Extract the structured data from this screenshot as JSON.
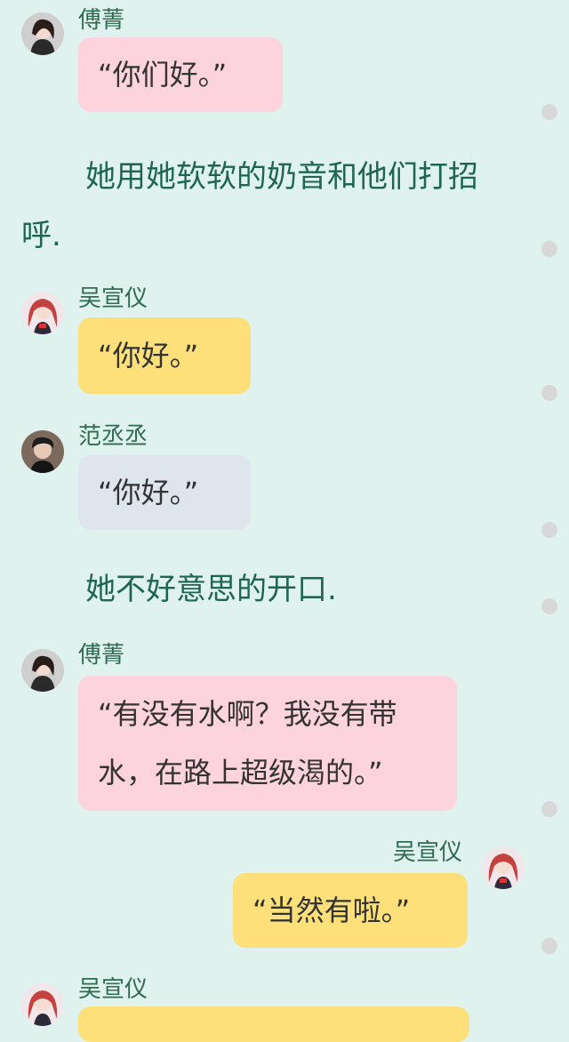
{
  "messages": {
    "m1": {
      "name": "傅菁",
      "text": "“你们好。”"
    },
    "narration1": {
      "line1": "她用她软软的奶音和他们打招",
      "line2": "呼."
    },
    "m2": {
      "name": "吴宣仪",
      "text": "“你好。”"
    },
    "m3": {
      "name": "范丞丞",
      "text": "“你好。”"
    },
    "narration2": {
      "line1": "她不好意思的开口."
    },
    "m4": {
      "name": "傅菁",
      "line1": "“有没有水啊？我没有带",
      "line2": "水，在路上超级渴的。”"
    },
    "m5": {
      "name": "吴宣仪",
      "text": "“当然有啦。”"
    },
    "m6": {
      "name": "吴宣仪",
      "text": ""
    }
  },
  "colors": {
    "background": "#e0f2ee",
    "pink_bubble": "#fdd3dd",
    "yellow_bubble": "#fde07a",
    "grey_bubble": "#dfe5ec",
    "narration_text": "#1e6650",
    "name_text": "#2f6b52"
  },
  "icons": {
    "avatar_fu": "avatar-fu-jing-icon",
    "avatar_wu": "avatar-wu-xuanyi-icon",
    "avatar_fan": "avatar-fan-chengcheng-icon",
    "scroll_dot": "scroll-dot-icon"
  }
}
